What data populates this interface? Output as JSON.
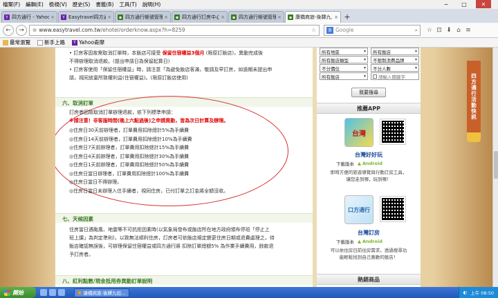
{
  "menu": [
    "檔案(F)",
    "編輯(E)",
    "檢視(V)",
    "歷史(S)",
    "書籤(B)",
    "工具(T)",
    "說明(H)"
  ],
  "window_controls": {
    "min": "−",
    "max": "□",
    "close": "✕"
  },
  "tabs": [
    {
      "label": "四方通行 - Yahoo...",
      "favicon": "Y",
      "color": "#6b1fa8"
    },
    {
      "label": "Easytravel四方通...",
      "favicon": "Y",
      "color": "#6b1fa8"
    },
    {
      "label": "四方通行帳號管理...",
      "favicon": "▪",
      "color": "#3a7a22"
    },
    {
      "label": "四方通行訂房中心...",
      "favicon": "▪",
      "color": "#3a7a22"
    },
    {
      "label": "四方通行帳號管理...",
      "favicon": "▪",
      "color": "#3a7a22"
    },
    {
      "label": "康橋商旅-後驛九...",
      "favicon": "▪",
      "color": "#3a7a22",
      "active": true
    }
  ],
  "tab_new": "+",
  "nav": {
    "back": "←",
    "forward": "→",
    "url_host": "www.easytravel.com.tw",
    "url_path": "/ehotel/orderknow.aspx?h=8259",
    "search_placeholder": "Google",
    "icons": [
      "☆",
      "⊡",
      "⬇",
      "⌂",
      "≡"
    ]
  },
  "bookmarks": [
    "最常瀏覽",
    "新手上路",
    "Yahoo奇摩"
  ],
  "content": {
    "intro_lines": [
      "• 訂房客因故需取消訂單時，本飯店可接受 保留住宿權益3個月 (限原訂飯店)，異動完成後",
      "  不得辦理取消退款。(提出申請日為保留起算日)",
      "• 訂房客使用「保留住宿權益」時，請注意「為避免飯店客滿，敬請及早訂房，如逾期未提出申",
      "  請，視同放棄所致權利益(住宿權益)。(限原訂飯店使用)"
    ],
    "intro_highlight": "保留住宿權益3個月",
    "section6_title": "六、取消訂單",
    "cancel_intro": "訂房者因故取消訂單辦理退款，依下列標準申請：",
    "cancel_warning": "※請注意！非客服時間(晚上六點過後)之申請異動，皆為次日計算及辦理。",
    "cancel_rules": [
      "◎住房日30天前辦理者，訂單費用扣除總計5%為手續費",
      "◎住房日14天前辦理者，訂單費用扣除總計10%為手續費",
      "◎住房日7天前辦理者，訂單費用扣除總計15%為手續費",
      "◎住房日4天前辦理者，訂單費用扣除總計30%為手續費",
      "◎住房日1天前辦理者，訂單費用扣除總計50%為手續費",
      "◎住房日當日辦理者，訂單費用扣除總計100%為手續費",
      "◎住房日當日不得辦理。",
      "◎住房日當日未辦理入住手續者，視同住房，已付訂單之訂金將全額沒收。"
    ],
    "section7_title": "七、天候因素",
    "weather_lines": [
      "住房當日遇颱風、地震等不可抗拒因素時(以氣象局發布或飯店所在地方政府頒布停班「停止上",
      "班上課」為判定準則)，以致無法順利住房，訂房者可依飯店規定變更住房日期或退費處理之，待",
      "飯店確認無誤後，可辦理保留住宿權益或四方通行將 扣除訂單總額5% 為作業手續費用，餘款退",
      "予訂房者。"
    ],
    "section8_title": "八、紅利點數/現金抵用券異動訂單說明"
  },
  "sidebar": {
    "selects": [
      [
        "所有地區",
        "所有飯店"
      ],
      [
        "所有飯店類型",
        "不限制消費品牌"
      ],
      [
        "不分價位",
        "不分人數"
      ],
      [
        "所有飯店",
        ""
      ]
    ],
    "keyword_placeholder": "請輸入關鍵字",
    "search_button": "我要搜尋",
    "app_header": "推薦APP",
    "app1": {
      "icon_text": "台灣",
      "title": "台灣好好玩",
      "download": "下載版本",
      "android": "Android",
      "desc": [
        "即時方便的旅遊導覽與行動訂房工具，",
        "讓您走到哪，玩到哪！"
      ]
    },
    "app2": {
      "icon_text": "口方通行",
      "title": "台灣訂房",
      "download": "下載版本",
      "android": "Android",
      "desc": [
        "可以依住房日前住房需求，透過搜尋功",
        "能輕鬆找到自己喜歡的飯店！"
      ]
    },
    "hot_header": "熱銷商品"
  },
  "badge": "四方通行活動快訊",
  "taskbar": {
    "start": "開始",
    "window": "康橋商旅-後驛九如...",
    "clock": "上午 08:50"
  }
}
